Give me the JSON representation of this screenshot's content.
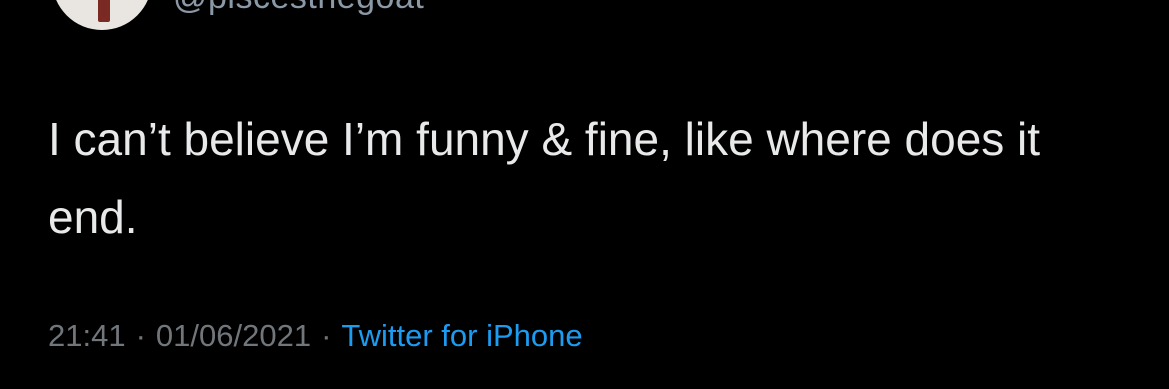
{
  "tweet": {
    "handle": "@piscesthegoat",
    "text": "I can’t believe I’m funny & fine, like where does it end.",
    "time": "21:41",
    "date": "01/06/2021",
    "separator": "·",
    "source": "Twitter for iPhone"
  },
  "colors": {
    "background": "#000000",
    "text": "#e7e9ea",
    "meta": "#71767b",
    "link": "#1d9bf0"
  }
}
